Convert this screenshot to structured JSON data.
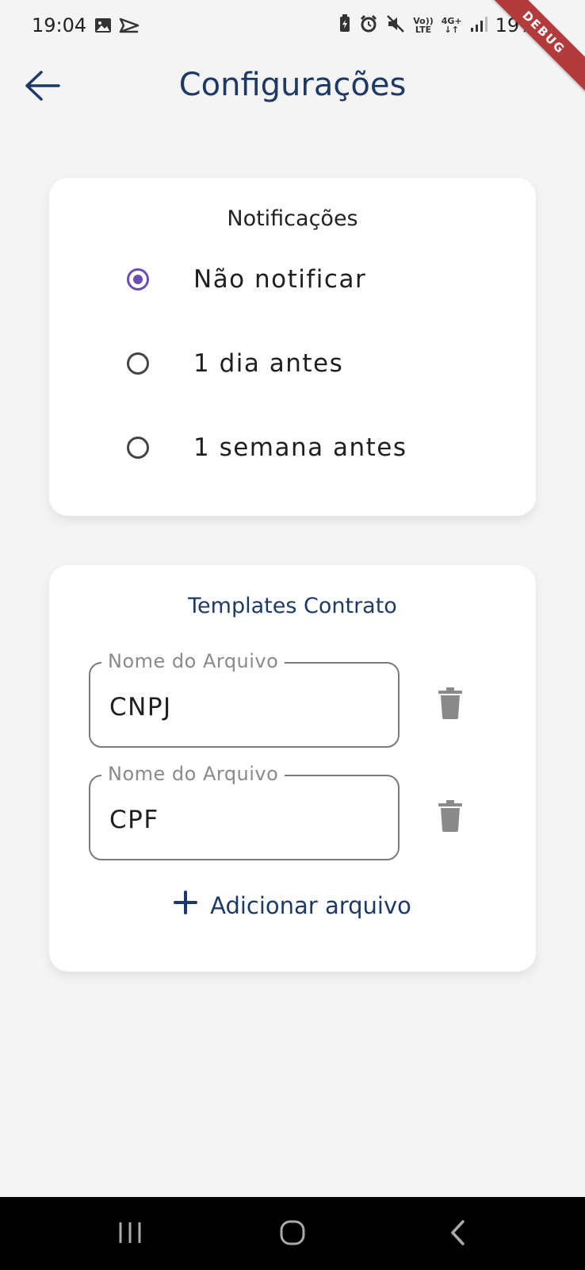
{
  "status_bar": {
    "time": "19:04",
    "left_icons": [
      "image-icon",
      "send-icon"
    ],
    "right_icons": [
      "battery-saver-icon",
      "alarm-icon",
      "mute-icon",
      "volte-icon",
      "network-4g-icon",
      "signal-icon"
    ],
    "volte_top": "Vo))",
    "volte_bottom": "LTE",
    "net_top": "4G+",
    "net_bottom": "↓↑",
    "battery": "19%",
    "debug_label": "DEBUG"
  },
  "app_bar": {
    "back_icon": "arrow-left-icon",
    "title": "Configurações"
  },
  "notifications": {
    "title": "Notificações",
    "options": [
      {
        "label": "Não notificar",
        "selected": true
      },
      {
        "label": "1 dia antes",
        "selected": false
      },
      {
        "label": "1 semana antes",
        "selected": false
      }
    ]
  },
  "templates": {
    "title": "Templates Contrato",
    "files": [
      {
        "label": "Nome do Arquivo",
        "value": "CNPJ"
      },
      {
        "label": "Nome do Arquivo",
        "value": "CPF"
      }
    ],
    "add_label": "Adicionar arquivo",
    "add_icon": "plus-icon",
    "delete_icon": "trash-icon"
  },
  "nav_bar": {
    "icons": [
      "recents-icon",
      "home-icon",
      "back-icon"
    ]
  },
  "colors": {
    "primary": "#1d3a66",
    "radio_selected": "#6a4fb3",
    "background": "#f4f4f4",
    "debug_ribbon": "#b23b3b"
  }
}
